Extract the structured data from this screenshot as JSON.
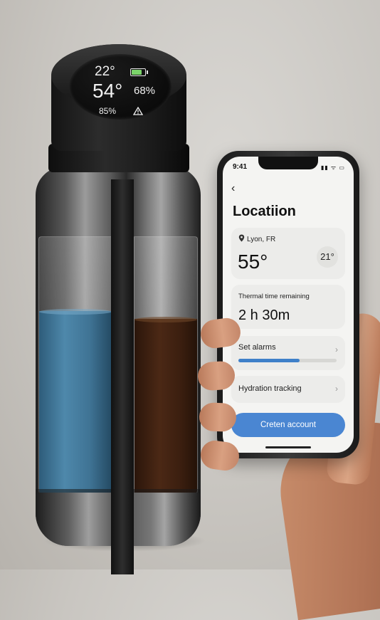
{
  "bottle": {
    "display": {
      "temp_top": "22°",
      "temp_main": "54°",
      "humidity": "68%",
      "level": "85%",
      "battery_level": 0.85,
      "battery_icon": "battery-icon",
      "warning_icon": "warning-icon"
    },
    "colors": {
      "water": "#4e88ab",
      "coffee": "#4b2815"
    }
  },
  "phone": {
    "status": {
      "time": "9:41",
      "icons": "▮▮ ᯤ ▭"
    },
    "back_icon": "chevron-left-icon",
    "title": "Locatiion",
    "location": {
      "pin_icon": "location-pin-icon",
      "name": "Lyon, FR",
      "temp": "55°",
      "temp_alt": "21°"
    },
    "thermal": {
      "label": "Thermal time remaining",
      "value": "2 h 30m"
    },
    "alarms": {
      "label": "Set alarms",
      "progress": 0.62
    },
    "hydration": {
      "label": "Hydration tracking"
    },
    "cta": {
      "label": "Creten account"
    },
    "accent": "#4a86d2"
  }
}
